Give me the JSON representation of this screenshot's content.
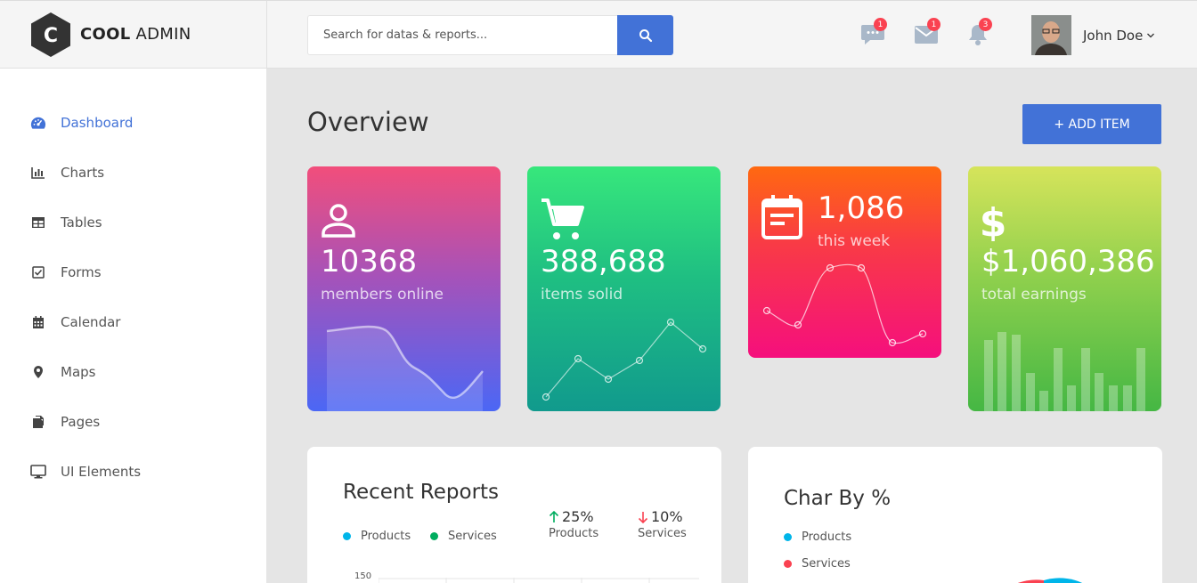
{
  "brand": {
    "bold": "COOL",
    "rest": " ADMIN",
    "logo_letter": "C"
  },
  "search": {
    "placeholder": "Search for datas & reports..."
  },
  "notifications": [
    {
      "icon": "comment-icon",
      "count": "1"
    },
    {
      "icon": "mail-icon",
      "count": "1"
    },
    {
      "icon": "bell-icon",
      "count": "3"
    }
  ],
  "account": {
    "name": "John Doe"
  },
  "sidebar": {
    "items": [
      {
        "label": "Dashboard",
        "icon": "tachometer-icon",
        "active": true
      },
      {
        "label": "Charts",
        "icon": "bar-chart-icon"
      },
      {
        "label": "Tables",
        "icon": "table-icon"
      },
      {
        "label": "Forms",
        "icon": "check-square-icon"
      },
      {
        "label": "Calendar",
        "icon": "calendar-icon"
      },
      {
        "label": "Maps",
        "icon": "map-marker-icon"
      },
      {
        "label": "Pages",
        "icon": "copy-icon"
      },
      {
        "label": "UI Elements",
        "icon": "desktop-icon"
      }
    ]
  },
  "main": {
    "title": "Overview",
    "add_button": "+ ADD ITEM",
    "cards": [
      {
        "icon": "account-icon",
        "value": "10368",
        "label": "members online"
      },
      {
        "icon": "shopping-cart-icon",
        "value": "388,688",
        "label": "items solid"
      },
      {
        "icon": "calendar-note-icon",
        "value": "1,086",
        "label": "this week"
      },
      {
        "icon": "dollar-icon",
        "value": "$1,060,386",
        "label": "total earnings"
      }
    ],
    "recent_reports": {
      "title": "Recent Reports",
      "legend": [
        {
          "label": "Products",
          "color": "#00b5e9"
        },
        {
          "label": "Services",
          "color": "#00ad5f"
        }
      ],
      "stats": [
        {
          "value": "25%",
          "label": "Products",
          "direction": "up",
          "color": "#00ad5f"
        },
        {
          "value": "10%",
          "label": "Services",
          "direction": "down",
          "color": "#fa4251"
        }
      ],
      "y_tick": "150"
    },
    "char_by": {
      "title": "Char By %",
      "legend": [
        {
          "label": "Products",
          "color": "#00b5e9"
        },
        {
          "label": "Services",
          "color": "#fa4251"
        }
      ]
    }
  },
  "colors": {
    "accent": "#4272d7",
    "badge": "#fa4251"
  }
}
